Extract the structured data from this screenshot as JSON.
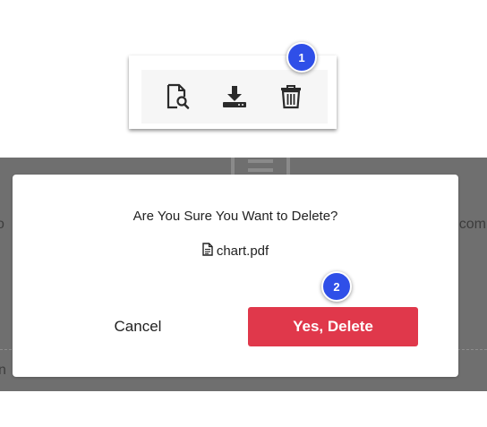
{
  "toolbar": {
    "icons": [
      "file-search-icon",
      "download-icon",
      "trash-icon"
    ]
  },
  "steps": {
    "step1": "1",
    "step2": "2"
  },
  "background": {
    "left_fragment": "o",
    "right_fragment": "r com",
    "bottom_fragment": "n"
  },
  "dialog": {
    "title": "Are You Sure You Want to Delete?",
    "file_icon": "document-icon",
    "file_name": "chart.pdf",
    "cancel_label": "Cancel",
    "confirm_label": "Yes, Delete"
  },
  "colors": {
    "confirm": "#e0384b",
    "badge": "#2f4fe8",
    "overlay": "#6f6f6f"
  }
}
